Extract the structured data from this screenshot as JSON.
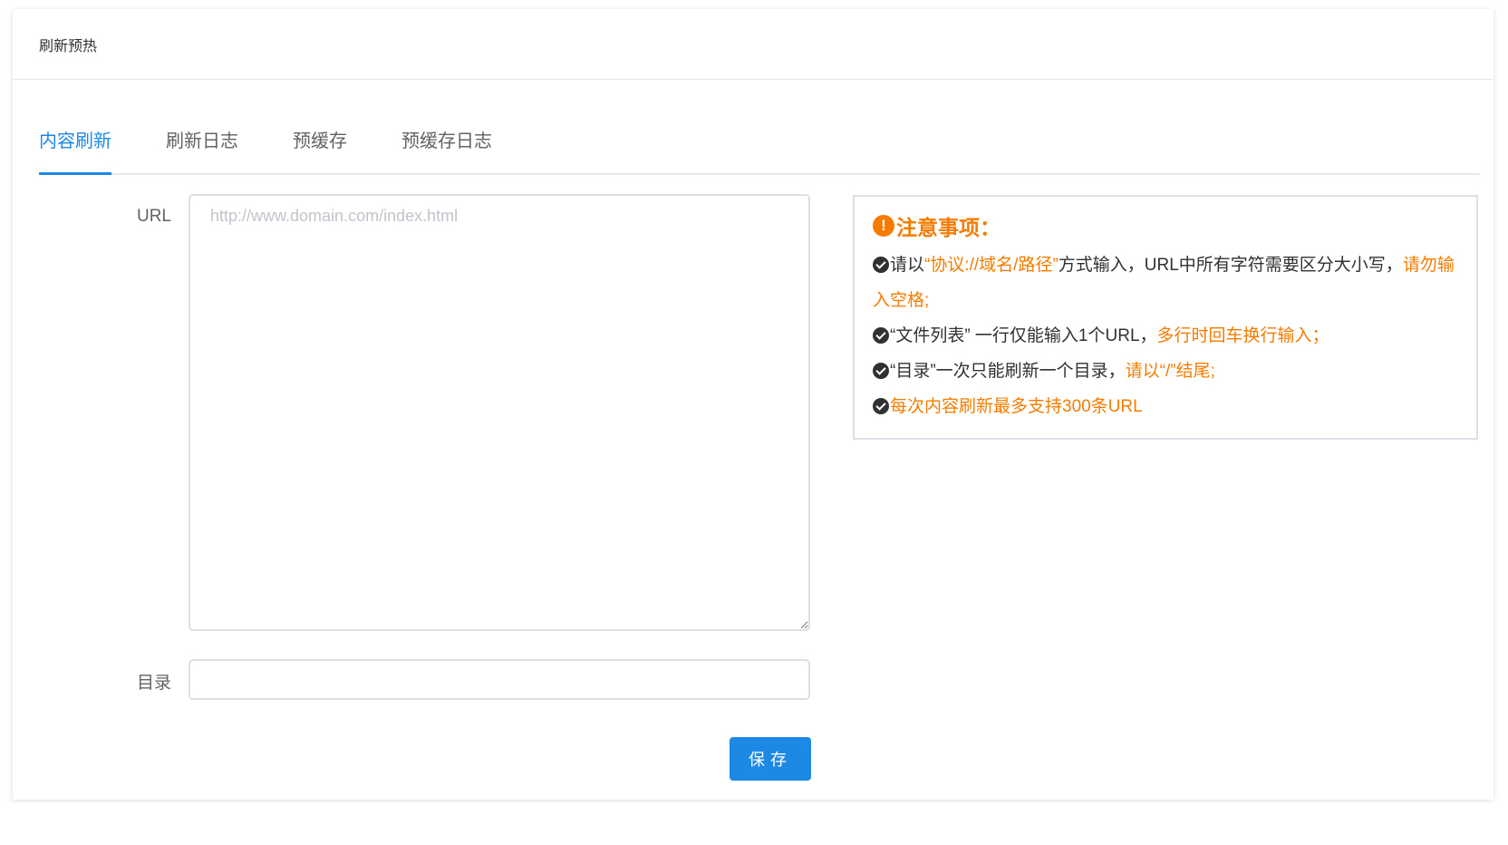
{
  "header": {
    "title": "刷新预热"
  },
  "tabs": [
    {
      "label": "内容刷新",
      "active": true
    },
    {
      "label": "刷新日志",
      "active": false
    },
    {
      "label": "预缓存",
      "active": false
    },
    {
      "label": "预缓存日志",
      "active": false
    }
  ],
  "form": {
    "url_label": "URL",
    "url_placeholder": "http://www.domain.com/index.html",
    "url_value": "",
    "dir_label": "目录",
    "dir_value": "",
    "save_label": "保存"
  },
  "notice": {
    "title": "注意事项：",
    "items": [
      {
        "text1": "请以",
        "highlight1": "“协议://域名/路径”",
        "text2": "方式输入，URL中所有字符需要区分大小写，",
        "highlight2": "请勿输入空格;"
      },
      {
        "text1": "“文件列表” 一行仅能输入1个URL，",
        "highlight1": "多行时回车换行输入；"
      },
      {
        "text1": "“目录”一次只能刷新一个目录，",
        "highlight1": "请以“/”结尾;"
      },
      {
        "highlight1": "每次内容刷新最多支持300条URL"
      }
    ]
  },
  "colors": {
    "primary": "#1e88e5",
    "warning": "#f57c00",
    "text": "#303133",
    "border": "#dcdfe6"
  }
}
